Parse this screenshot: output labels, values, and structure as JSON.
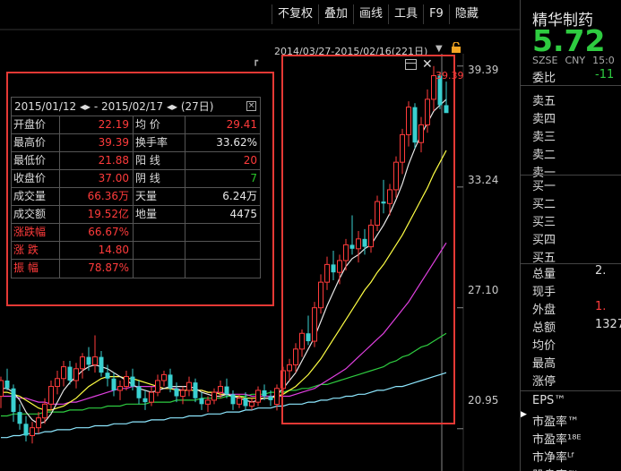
{
  "toolbar": {
    "items": [
      "不复权",
      "叠加",
      "画线",
      "工具",
      "F9",
      "隐藏"
    ]
  },
  "chart_header": {
    "range": "2014/03/27-2015/02/16(221日)"
  },
  "stats": {
    "header": "2015/01/12 ◂▸ - 2015/02/17 ◂▸  (27日)",
    "close_symbol": "×",
    "rows": [
      {
        "l1": "开盘价",
        "v1": "22.19",
        "l2": "均 价",
        "v2": "29.41"
      },
      {
        "l1": "最高价",
        "v1": "39.39",
        "l2": "换手率",
        "v2": "33.62%"
      },
      {
        "l1": "最低价",
        "v1": "21.88",
        "l2": "阳 线",
        "v2": "20"
      },
      {
        "l1": "收盘价",
        "v1": "37.00",
        "l2": "阴 线",
        "v2": "7"
      },
      {
        "l1": "成交量",
        "v1": "66.36万",
        "l2": "天量",
        "v2": "6.24万"
      },
      {
        "l1": "成交额",
        "v1": "19.52亿",
        "l2": "地量",
        "v2": "4475"
      },
      {
        "l1": "涨跌幅",
        "v1": "66.67%",
        "l2": "",
        "v2": ""
      },
      {
        "l1": "涨 跌",
        "v1": "14.80",
        "l2": "",
        "v2": ""
      },
      {
        "l1": "振 幅",
        "v1": "78.87%",
        "l2": "",
        "v2": ""
      }
    ]
  },
  "chart_data": {
    "type": "candlestick",
    "y_ticks": [
      "39.39",
      "33.24",
      "27.10",
      "20.95"
    ],
    "ylim": [
      18.8,
      41.2
    ],
    "high_label": "39.39",
    "colors": {
      "up": "#ff3b3b",
      "down": "#3ad0d0",
      "ma5": "#e8e8e8",
      "ma10": "#ffff44",
      "ma20": "#e040e0",
      "ma60": "#2ecc40",
      "ma120": "#8ee8ff"
    },
    "candles": [
      [
        22.6,
        23.6,
        22.0,
        23.4
      ],
      [
        23.4,
        24.0,
        22.9,
        23.0
      ],
      [
        23.0,
        23.2,
        21.3,
        21.8
      ],
      [
        21.8,
        22.2,
        20.9,
        21.2
      ],
      [
        21.2,
        21.6,
        20.3,
        20.6
      ],
      [
        20.6,
        21.3,
        20.2,
        21.0
      ],
      [
        21.0,
        21.8,
        20.7,
        21.5
      ],
      [
        21.5,
        22.5,
        21.2,
        22.2
      ],
      [
        22.2,
        23.4,
        21.9,
        23.1
      ],
      [
        23.1,
        23.9,
        22.7,
        23.5
      ],
      [
        23.5,
        24.4,
        23.1,
        24.1
      ],
      [
        24.1,
        24.4,
        23.2,
        23.4
      ],
      [
        23.4,
        24.3,
        23.0,
        24.0
      ],
      [
        24.0,
        24.8,
        23.5,
        24.6
      ],
      [
        24.6,
        25.1,
        23.9,
        24.2
      ],
      [
        24.2,
        25.7,
        23.8,
        24.6
      ],
      [
        24.6,
        24.9,
        23.6,
        23.8
      ],
      [
        23.8,
        24.2,
        23.1,
        23.5
      ],
      [
        23.5,
        23.8,
        22.6,
        22.9
      ],
      [
        22.9,
        23.4,
        22.4,
        23.1
      ],
      [
        23.1,
        23.9,
        22.9,
        23.6
      ],
      [
        23.6,
        24.0,
        22.9,
        23.1
      ],
      [
        23.1,
        23.4,
        22.2,
        22.5
      ],
      [
        22.5,
        22.9,
        21.9,
        22.3
      ],
      [
        22.3,
        23.1,
        22.1,
        22.8
      ],
      [
        22.8,
        23.7,
        22.6,
        23.4
      ],
      [
        23.4,
        23.9,
        23.1,
        23.7
      ],
      [
        23.7,
        24.0,
        22.8,
        23.0
      ],
      [
        23.0,
        23.3,
        22.3,
        22.6
      ],
      [
        22.6,
        23.1,
        22.2,
        22.9
      ],
      [
        22.9,
        23.6,
        22.6,
        23.3
      ],
      [
        23.3,
        23.5,
        22.3,
        22.5
      ],
      [
        22.5,
        22.8,
        21.9,
        22.2
      ],
      [
        22.2,
        22.6,
        21.8,
        22.4
      ],
      [
        22.4,
        23.0,
        22.2,
        22.8
      ],
      [
        22.8,
        23.4,
        22.5,
        23.1
      ],
      [
        23.1,
        23.5,
        22.5,
        22.7
      ],
      [
        22.7,
        22.9,
        21.9,
        22.2
      ],
      [
        22.2,
        22.7,
        22.0,
        22.5
      ],
      [
        22.5,
        22.8,
        21.9,
        22.1
      ],
      [
        22.1,
        22.5,
        21.9,
        22.3
      ],
      [
        22.3,
        23.1,
        22.1,
        22.9
      ],
      [
        22.9,
        23.2,
        22.4,
        22.6
      ],
      [
        22.6,
        22.9,
        22.1,
        22.4
      ],
      [
        22.19,
        23.2,
        21.88,
        23.0
      ],
      [
        23.0,
        24.1,
        22.7,
        23.9
      ],
      [
        23.9,
        24.5,
        23.4,
        24.2
      ],
      [
        24.2,
        25.3,
        23.8,
        25.0
      ],
      [
        25.0,
        26.0,
        24.6,
        25.8
      ],
      [
        25.8,
        26.7,
        25.2,
        25.4
      ],
      [
        25.4,
        27.4,
        25.1,
        27.1
      ],
      [
        27.1,
        28.8,
        26.8,
        28.4
      ],
      [
        28.4,
        29.7,
        28.0,
        29.3
      ],
      [
        29.3,
        30.0,
        28.5,
        28.9
      ],
      [
        28.9,
        29.8,
        28.3,
        29.5
      ],
      [
        29.5,
        30.6,
        29.0,
        30.3
      ],
      [
        30.3,
        31.8,
        29.8,
        30.1
      ],
      [
        30.1,
        31.0,
        29.4,
        30.6
      ],
      [
        30.6,
        31.1,
        29.8,
        30.2
      ],
      [
        30.2,
        31.6,
        29.9,
        31.3
      ],
      [
        31.3,
        32.8,
        31.0,
        32.5
      ],
      [
        32.5,
        33.6,
        31.9,
        32.4
      ],
      [
        32.4,
        33.4,
        31.8,
        33.1
      ],
      [
        33.1,
        34.8,
        32.7,
        34.5
      ],
      [
        34.5,
        36.2,
        33.9,
        35.9
      ],
      [
        35.9,
        37.6,
        35.3,
        37.3
      ],
      [
        37.3,
        37.5,
        35.2,
        35.5
      ],
      [
        35.5,
        36.8,
        35.0,
        36.4
      ],
      [
        36.4,
        38.2,
        36.0,
        37.7
      ],
      [
        37.7,
        39.39,
        37.1,
        38.9
      ],
      [
        38.9,
        39.1,
        37.2,
        37.4
      ],
      [
        37.4,
        38.6,
        37.1,
        37.0
      ]
    ],
    "ma": {
      "ma5": [
        23.0,
        23.0,
        22.8,
        22.4,
        21.8,
        21.4,
        21.2,
        21.3,
        21.7,
        22.3,
        22.9,
        23.3,
        23.6,
        23.9,
        24.1,
        24.2,
        24.1,
        24.0,
        23.8,
        23.6,
        23.4,
        23.2,
        23.0,
        22.9,
        22.8,
        22.9,
        23.0,
        23.1,
        23.1,
        23.1,
        23.1,
        23.0,
        22.8,
        22.7,
        22.6,
        22.6,
        22.7,
        22.6,
        22.5,
        22.4,
        22.3,
        22.4,
        22.5,
        22.5,
        22.7,
        23.0,
        23.4,
        23.8,
        24.4,
        25.0,
        25.6,
        26.4,
        27.2,
        27.9,
        28.6,
        29.2,
        29.6,
        29.8,
        30.1,
        30.3,
        30.8,
        31.3,
        31.9,
        32.6,
        33.4,
        34.4,
        35.2,
        35.9,
        36.5,
        37.1,
        37.4,
        37.7
      ],
      "ma10": [
        22.8,
        22.8,
        22.7,
        22.6,
        22.4,
        22.2,
        22.0,
        21.9,
        21.9,
        22.0,
        22.1,
        22.3,
        22.5,
        22.8,
        23.1,
        23.3,
        23.5,
        23.6,
        23.6,
        23.6,
        23.5,
        23.5,
        23.4,
        23.3,
        23.2,
        23.1,
        23.0,
        23.0,
        22.9,
        22.9,
        22.9,
        22.9,
        22.9,
        22.8,
        22.8,
        22.7,
        22.7,
        22.6,
        22.6,
        22.5,
        22.5,
        22.5,
        22.5,
        22.5,
        22.6,
        22.7,
        22.9,
        23.1,
        23.4,
        23.7,
        24.1,
        24.5,
        25.0,
        25.5,
        26.0,
        26.5,
        27.0,
        27.5,
        28.0,
        28.4,
        28.9,
        29.3,
        29.8,
        30.3,
        30.8,
        31.4,
        32.0,
        32.6,
        33.2,
        33.9,
        34.5,
        35.1
      ],
      "ma20": [
        22.6,
        22.6,
        22.6,
        22.5,
        22.5,
        22.4,
        22.3,
        22.3,
        22.2,
        22.2,
        22.2,
        22.3,
        22.3,
        22.4,
        22.5,
        22.6,
        22.7,
        22.8,
        22.9,
        23.0,
        23.0,
        23.1,
        23.1,
        23.1,
        23.1,
        23.1,
        23.0,
        23.0,
        23.0,
        22.9,
        22.9,
        22.9,
        22.9,
        22.8,
        22.8,
        22.8,
        22.7,
        22.7,
        22.7,
        22.7,
        22.6,
        22.6,
        22.6,
        22.6,
        22.6,
        22.6,
        22.6,
        22.7,
        22.8,
        22.9,
        23.0,
        23.2,
        23.4,
        23.6,
        23.8,
        24.0,
        24.3,
        24.6,
        24.9,
        25.2,
        25.5,
        25.8,
        26.2,
        26.6,
        27.0,
        27.4,
        27.9,
        28.4,
        28.9,
        29.4,
        29.9,
        30.4
      ],
      "ma60": [
        21.6,
        21.6,
        21.7,
        21.7,
        21.7,
        21.7,
        21.7,
        21.8,
        21.8,
        21.8,
        21.8,
        21.9,
        21.9,
        21.9,
        22.0,
        22.0,
        22.0,
        22.1,
        22.1,
        22.1,
        22.2,
        22.2,
        22.2,
        22.2,
        22.3,
        22.3,
        22.3,
        22.3,
        22.4,
        22.4,
        22.4,
        22.4,
        22.5,
        22.5,
        22.5,
        22.5,
        22.6,
        22.6,
        22.6,
        22.6,
        22.7,
        22.7,
        22.7,
        22.8,
        22.8,
        22.8,
        22.9,
        22.9,
        23.0,
        23.0,
        23.1,
        23.2,
        23.2,
        23.3,
        23.4,
        23.5,
        23.6,
        23.7,
        23.8,
        23.9,
        24.0,
        24.1,
        24.3,
        24.4,
        24.6,
        24.7,
        24.9,
        25.1,
        25.2,
        25.4,
        25.6,
        25.8
      ],
      "ma120": [
        20.5,
        20.5,
        20.6,
        20.6,
        20.7,
        20.7,
        20.7,
        20.8,
        20.8,
        20.9,
        20.9,
        20.9,
        21.0,
        21.0,
        21.0,
        21.1,
        21.1,
        21.1,
        21.2,
        21.2,
        21.2,
        21.3,
        21.3,
        21.3,
        21.4,
        21.4,
        21.4,
        21.5,
        21.5,
        21.5,
        21.6,
        21.6,
        21.6,
        21.7,
        21.7,
        21.7,
        21.8,
        21.8,
        21.8,
        21.9,
        21.9,
        22.0,
        22.0,
        22.0,
        22.1,
        22.1,
        22.2,
        22.2,
        22.2,
        22.3,
        22.3,
        22.4,
        22.4,
        22.5,
        22.5,
        22.6,
        22.6,
        22.7,
        22.7,
        22.8,
        22.9,
        22.9,
        23.0,
        23.1,
        23.1,
        23.2,
        23.3,
        23.4,
        23.5,
        23.6,
        23.7,
        23.8
      ]
    },
    "selection_start_index": 44
  },
  "quote": {
    "name": "精华制药",
    "price": "5.72",
    "exchange": "SZSE",
    "currency": "CNY",
    "time": "15:0",
    "weibi_label": "委比",
    "weibi_value": "-11",
    "sell_levels": [
      "卖五",
      "卖四",
      "卖三",
      "卖二",
      "卖一"
    ],
    "buy_levels": [
      "买一",
      "买二",
      "买三",
      "买四",
      "买五"
    ],
    "stats": [
      {
        "label": "总量",
        "value": "2."
      },
      {
        "label": "现手",
        "value": ""
      },
      {
        "label": "外盘",
        "value": "1."
      },
      {
        "label": "总额",
        "value": "1327."
      },
      {
        "label": "均价",
        "value": ""
      },
      {
        "label": "最高",
        "value": ""
      },
      {
        "label": "涨停",
        "value": ""
      }
    ],
    "ratios": [
      "EPS™",
      "市盈率™",
      "市盈率¹⁸ᴱ",
      "市净率ᴸᶠ",
      "股息率™"
    ]
  }
}
